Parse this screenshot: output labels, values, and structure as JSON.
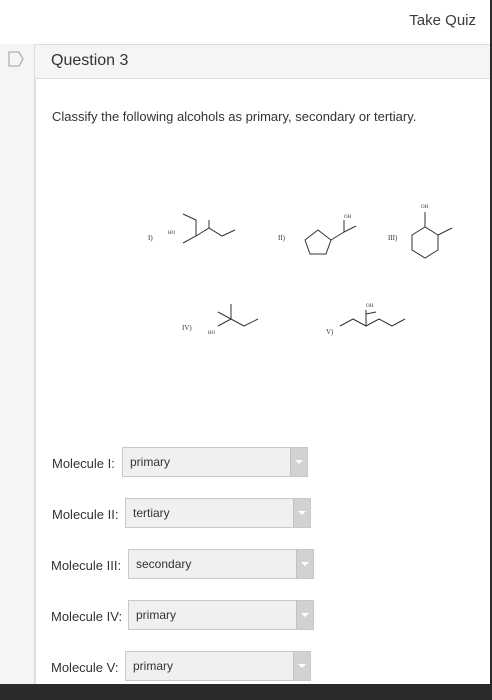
{
  "header": {
    "take_quiz": "Take Quiz"
  },
  "question": {
    "title": "Question 3",
    "prompt": "Classify the following alcohols as primary, secondary or tertiary."
  },
  "structure_labels": {
    "m1": "I)",
    "m2": "II)",
    "m3": "III)",
    "m4": "IV)",
    "m5": "V)",
    "ho": "HO",
    "oh": "OH"
  },
  "answers": [
    {
      "label": "Molecule I:",
      "value": "primary"
    },
    {
      "label": "Molecule II:",
      "value": "tertiary"
    },
    {
      "label": "Molecule III:",
      "value": "secondary"
    },
    {
      "label": "Molecule IV:",
      "value": "primary"
    },
    {
      "label": "Molecule V:",
      "value": "primary"
    }
  ]
}
